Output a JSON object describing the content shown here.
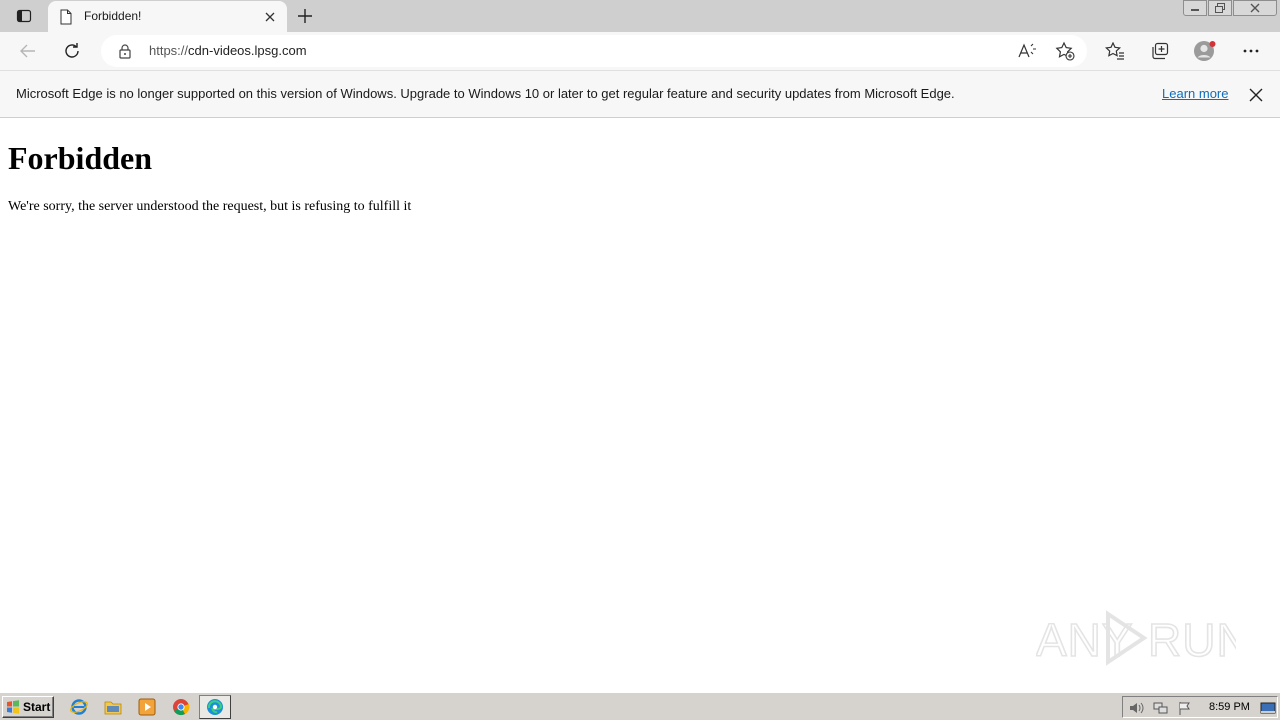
{
  "browser": {
    "tab": {
      "title": "Forbidden!",
      "favicon": "page-icon"
    },
    "url": {
      "protocol": "https://",
      "host": "cdn-videos.lpsg.com"
    },
    "icons": {
      "tab_actions": "tab-actions-icon",
      "new_tab": "plus-icon",
      "back": "arrow-left-icon",
      "refresh": "refresh-icon",
      "read_aloud": "read-aloud-icon",
      "add_favorite": "star-add-icon",
      "favorites": "favorites-icon",
      "collections": "collections-icon",
      "profile": "profile-icon",
      "menu": "more-icon"
    }
  },
  "infobar": {
    "message": "Microsoft Edge is no longer supported on this version of Windows. Upgrade to Windows 10 or later to get regular feature and security updates from Microsoft Edge.",
    "link": "Learn more"
  },
  "page": {
    "heading": "Forbidden",
    "message": "We're sorry, the server understood the request, but is refusing to fulfill it"
  },
  "watermark": {
    "text": "ANY RUN"
  },
  "taskbar": {
    "start_label": "Start",
    "quicklaunch": [
      "ie-icon",
      "explorer-icon",
      "media-player-icon",
      "chrome-icon",
      "edge-icon"
    ],
    "clock": "8:59 PM"
  },
  "colors": {
    "link": "#0f6cbd",
    "tabbar": "#cfcfcf",
    "toolbar": "#f7f7f7",
    "taskbar": "#d6d3ce",
    "profile_badge": "#d13438"
  }
}
